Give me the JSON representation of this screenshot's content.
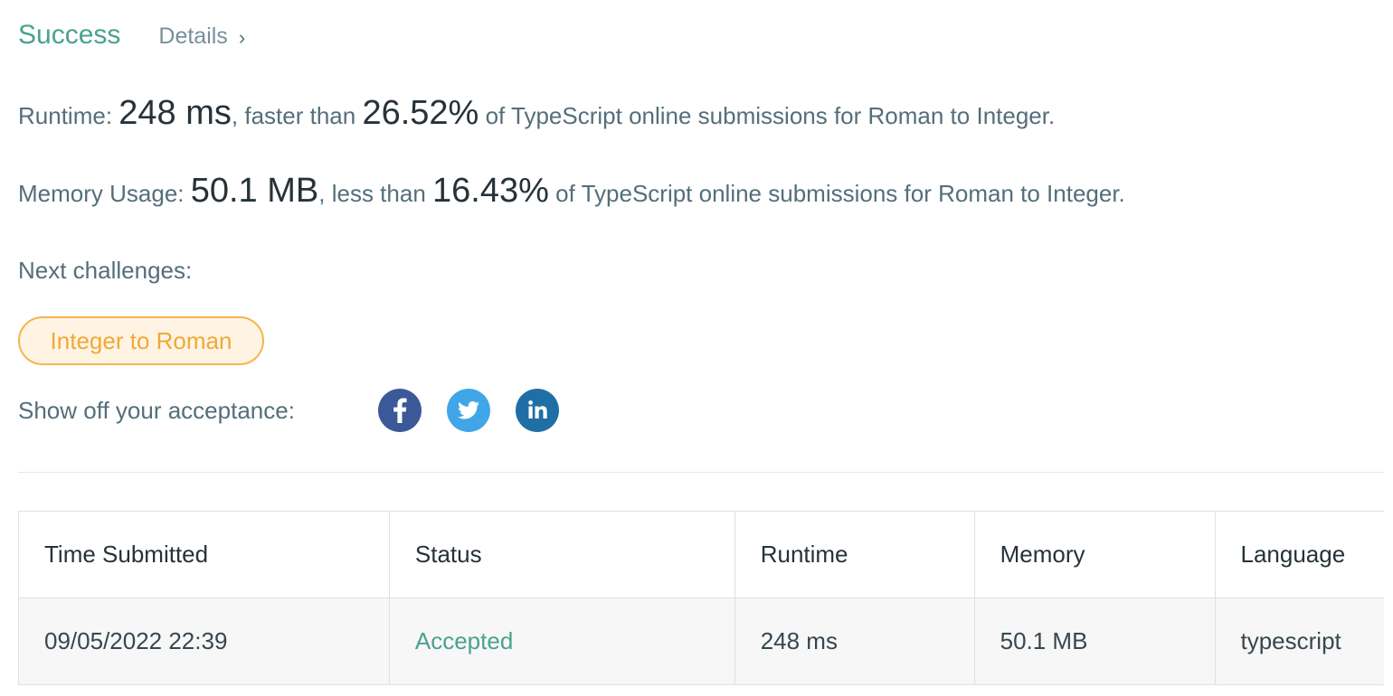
{
  "header": {
    "status": "Success",
    "details_label": "Details",
    "details_chevron": "›"
  },
  "runtime": {
    "label": "Runtime:",
    "value": "248 ms",
    "compare_text": ", faster than",
    "percent": "26.52%",
    "suffix": "of TypeScript online submissions for Roman to Integer."
  },
  "memory": {
    "label": "Memory Usage:",
    "value": "50.1 MB",
    "compare_text": ", less than",
    "percent": "16.43%",
    "suffix": "of TypeScript online submissions for Roman to Integer."
  },
  "next": {
    "label": "Next challenges:",
    "challenges": [
      "Integer to Roman"
    ]
  },
  "share": {
    "label": "Show off your acceptance:",
    "icons": [
      "facebook-icon",
      "twitter-icon",
      "linkedin-icon"
    ],
    "colors": {
      "facebook": "#3b5998",
      "twitter": "#40a6e8",
      "linkedin": "#1f6fa6"
    }
  },
  "table": {
    "headers": [
      "Time Submitted",
      "Status",
      "Runtime",
      "Memory",
      "Language"
    ],
    "rows": [
      {
        "time": "09/05/2022 22:39",
        "status": "Accepted",
        "runtime": "248 ms",
        "memory": "50.1 MB",
        "language": "typescript"
      }
    ]
  },
  "colors": {
    "success": "#4aa28e",
    "challenge_border": "#f5b44d",
    "challenge_text": "#f0a937",
    "challenge_bg": "#fff4e3"
  }
}
